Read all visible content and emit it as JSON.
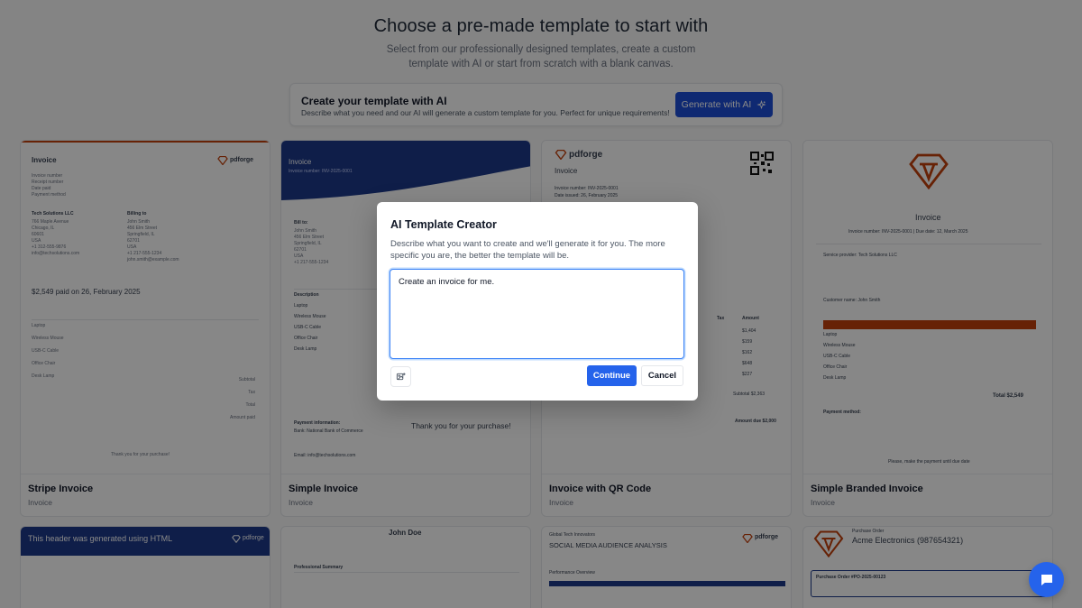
{
  "hero": {
    "title": "Choose a pre-made template to start with",
    "subtitle": "Select from our professionally designed templates, create a custom template with AI or start from scratch with a blank canvas."
  },
  "ai_banner": {
    "title": "Create your template with AI",
    "description": "Describe what you need and our AI will generate a custom template for you. Perfect for unique requirements!",
    "button_label": "Generate with AI",
    "button_icon": "sparkles-icon"
  },
  "templates": [
    {
      "title": "Stripe Invoice",
      "subtitle": "Invoice",
      "preview": {
        "heading": "Invoice",
        "brand": "pdforge",
        "paid_line": "$2,549 paid on 26, February 2025",
        "from_name": "Tech Solutions LLC",
        "bill_to": "Billing to",
        "footer": "Thank you for your purchase!"
      }
    },
    {
      "title": "Simple Invoice",
      "subtitle": "Invoice",
      "preview": {
        "heading": "Invoice",
        "invoice_no": "Invoice number: INV-2025-0001",
        "bill_to": "Bill to:",
        "description_head": "Description",
        "items": [
          "Laptop",
          "Wireless Mouse",
          "USB-C Cable",
          "Office Chair",
          "Desk Lamp"
        ],
        "thanks": "Thank you for your purchase!",
        "payment_info": "Payment information:",
        "bank": "Bank: National Bank of Commerce",
        "email": "Email: info@techsolutions.com"
      }
    },
    {
      "title": "Invoice with QR Code",
      "subtitle": "Invoice",
      "preview": {
        "brand": "pdforge",
        "heading": "Invoice",
        "invoice_no": "Invoice number: INV-2025-0001",
        "date_issued": "Date issued: 26, February 2025",
        "tax_head": "Tax",
        "amount_head": "Amount",
        "amounts": [
          "$1,404",
          "$159",
          "$162",
          "$648",
          "$227"
        ],
        "subtotal": "Subtotal $2,363",
        "amount_due": "Amount due $2,000"
      }
    },
    {
      "title": "Simple Branded Invoice",
      "subtitle": "Invoice",
      "preview": {
        "heading": "Invoice",
        "invoice_line": "Invoice number: INV-2025-0001 | Due date: 12, March 2025",
        "service_provider": "Service provider: Tech Solutions LLC",
        "customer": "Customer name: John Smith",
        "items": [
          "Laptop",
          "Wireless Mouse",
          "USB-C Cable",
          "Office Chair",
          "Desk Lamp"
        ],
        "total": "Total $2,549",
        "payment_method": "Payment method:",
        "footer": "Please, make the payment until due date"
      }
    }
  ],
  "second_row": [
    {
      "header": "This header was generated using HTML",
      "brand": "pdforge"
    },
    {
      "name": "John Doe",
      "section": "Professional Summary"
    },
    {
      "company": "Global Tech Innovators",
      "heading": "SOCIAL MEDIA AUDIENCE ANALYSIS",
      "section": "Performance Overview",
      "brand": "pdforge"
    },
    {
      "label": "Purchase Order",
      "company": "Acme Electronics (987654321)",
      "po": "Purchase Order #PO-2025-00123"
    }
  ],
  "modal": {
    "title": "AI Template Creator",
    "description": "Describe what you want to create and we'll generate it for you. The more specific you are, the better the template will be.",
    "prompt_value": "Create an invoice for me.",
    "attach_icon": "image-upload-icon",
    "continue_label": "Continue",
    "cancel_label": "Cancel"
  },
  "chat": {
    "icon": "chat-bubble-icon"
  },
  "colors": {
    "primary": "#2563eb",
    "brand_red": "#c2410c",
    "simple_invoice_header": "#1e3a8a",
    "overlay": "rgba(0,0,0,0.47)"
  }
}
